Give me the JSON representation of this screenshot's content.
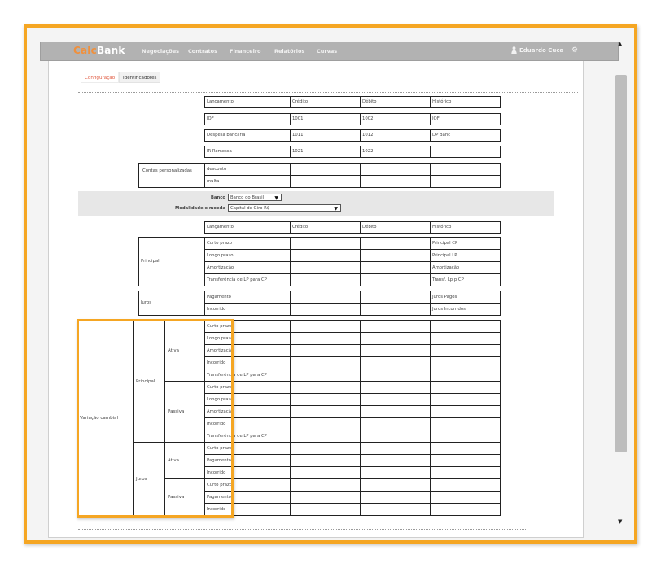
{
  "app": {
    "brand_prefix": "Calc",
    "brand_suffix": "Bank",
    "menu": [
      "Negociações",
      "Contratos",
      "Financeiro",
      "Relatórios",
      "Curvas"
    ],
    "user": "Eduardo Cuca",
    "user_icon": "user-icon",
    "settings_icon": "gear-icon"
  },
  "tabs": [
    "Configuração",
    "Identificadores"
  ],
  "table1": {
    "headers": [
      "Lançamento",
      "Crédito",
      "Débito",
      "Histórico"
    ],
    "rows": [
      [
        "IOF",
        "1001",
        "1002",
        "IOF"
      ],
      [
        "Despesa bancária",
        "1011",
        "1012",
        "DP Banc"
      ],
      [
        "IR Remessa",
        "1021",
        "1022",
        ""
      ]
    ]
  },
  "contas": {
    "label": "Contas personalizadas",
    "rows": [
      [
        "desconto",
        "",
        "",
        ""
      ],
      [
        "multa",
        "",
        "",
        ""
      ]
    ]
  },
  "selection": {
    "banco_label": "Banco",
    "banco_value": "Banco do Brasil",
    "modalidade_label": "Modalidade e moeda",
    "modalidade_value": "Capital de Giro   R$"
  },
  "table2": {
    "headers": [
      "Lançamento",
      "Crédito",
      "Débito",
      "Histórico"
    ],
    "principal_label": "Principal",
    "principal_rows": [
      [
        "Curto prazo",
        "",
        "",
        "Principal CP"
      ],
      [
        "Longo prazo",
        "",
        "",
        "Principal LP"
      ],
      [
        "Amortização",
        "",
        "",
        "Amortização"
      ],
      [
        "Transferência de LP para CP",
        "",
        "",
        "Transf. Lp p CP"
      ]
    ],
    "juros_label": "Juros",
    "juros_rows": [
      [
        "Pagamento",
        "",
        "",
        "Juros Pagos"
      ],
      [
        "Incorrido",
        "",
        "",
        "Juros Incorridos"
      ]
    ]
  },
  "variacao": {
    "label": "Variação cambial",
    "principal": "Principal",
    "juros": "Juros",
    "ativa": "Ativa",
    "passiva": "Passiva",
    "principal_ativa_rows": [
      "Curto prazo",
      "Longo prazo",
      "Amortização",
      "Incorrido",
      "Transferência de LP para CP"
    ],
    "principal_passiva_rows": [
      "Curto prazo",
      "Longo prazo",
      "Amortização",
      "Incorrido",
      "Transferência de LP para CP"
    ],
    "juros_ativa_rows": [
      "Curto prazo",
      "Pagamento",
      "Incorrido"
    ],
    "juros_passiva_rows": [
      "Curto prazo",
      "Pagamento",
      "Incorrido"
    ]
  },
  "colors": {
    "frame": "#f5a623",
    "brand_accent": "#f0903c",
    "navbar": "#b2b2b2",
    "active_tab": "#e0563c"
  },
  "scrollbar": {
    "up_icon": "arrow-up-icon",
    "down_icon": "arrow-down-icon"
  }
}
